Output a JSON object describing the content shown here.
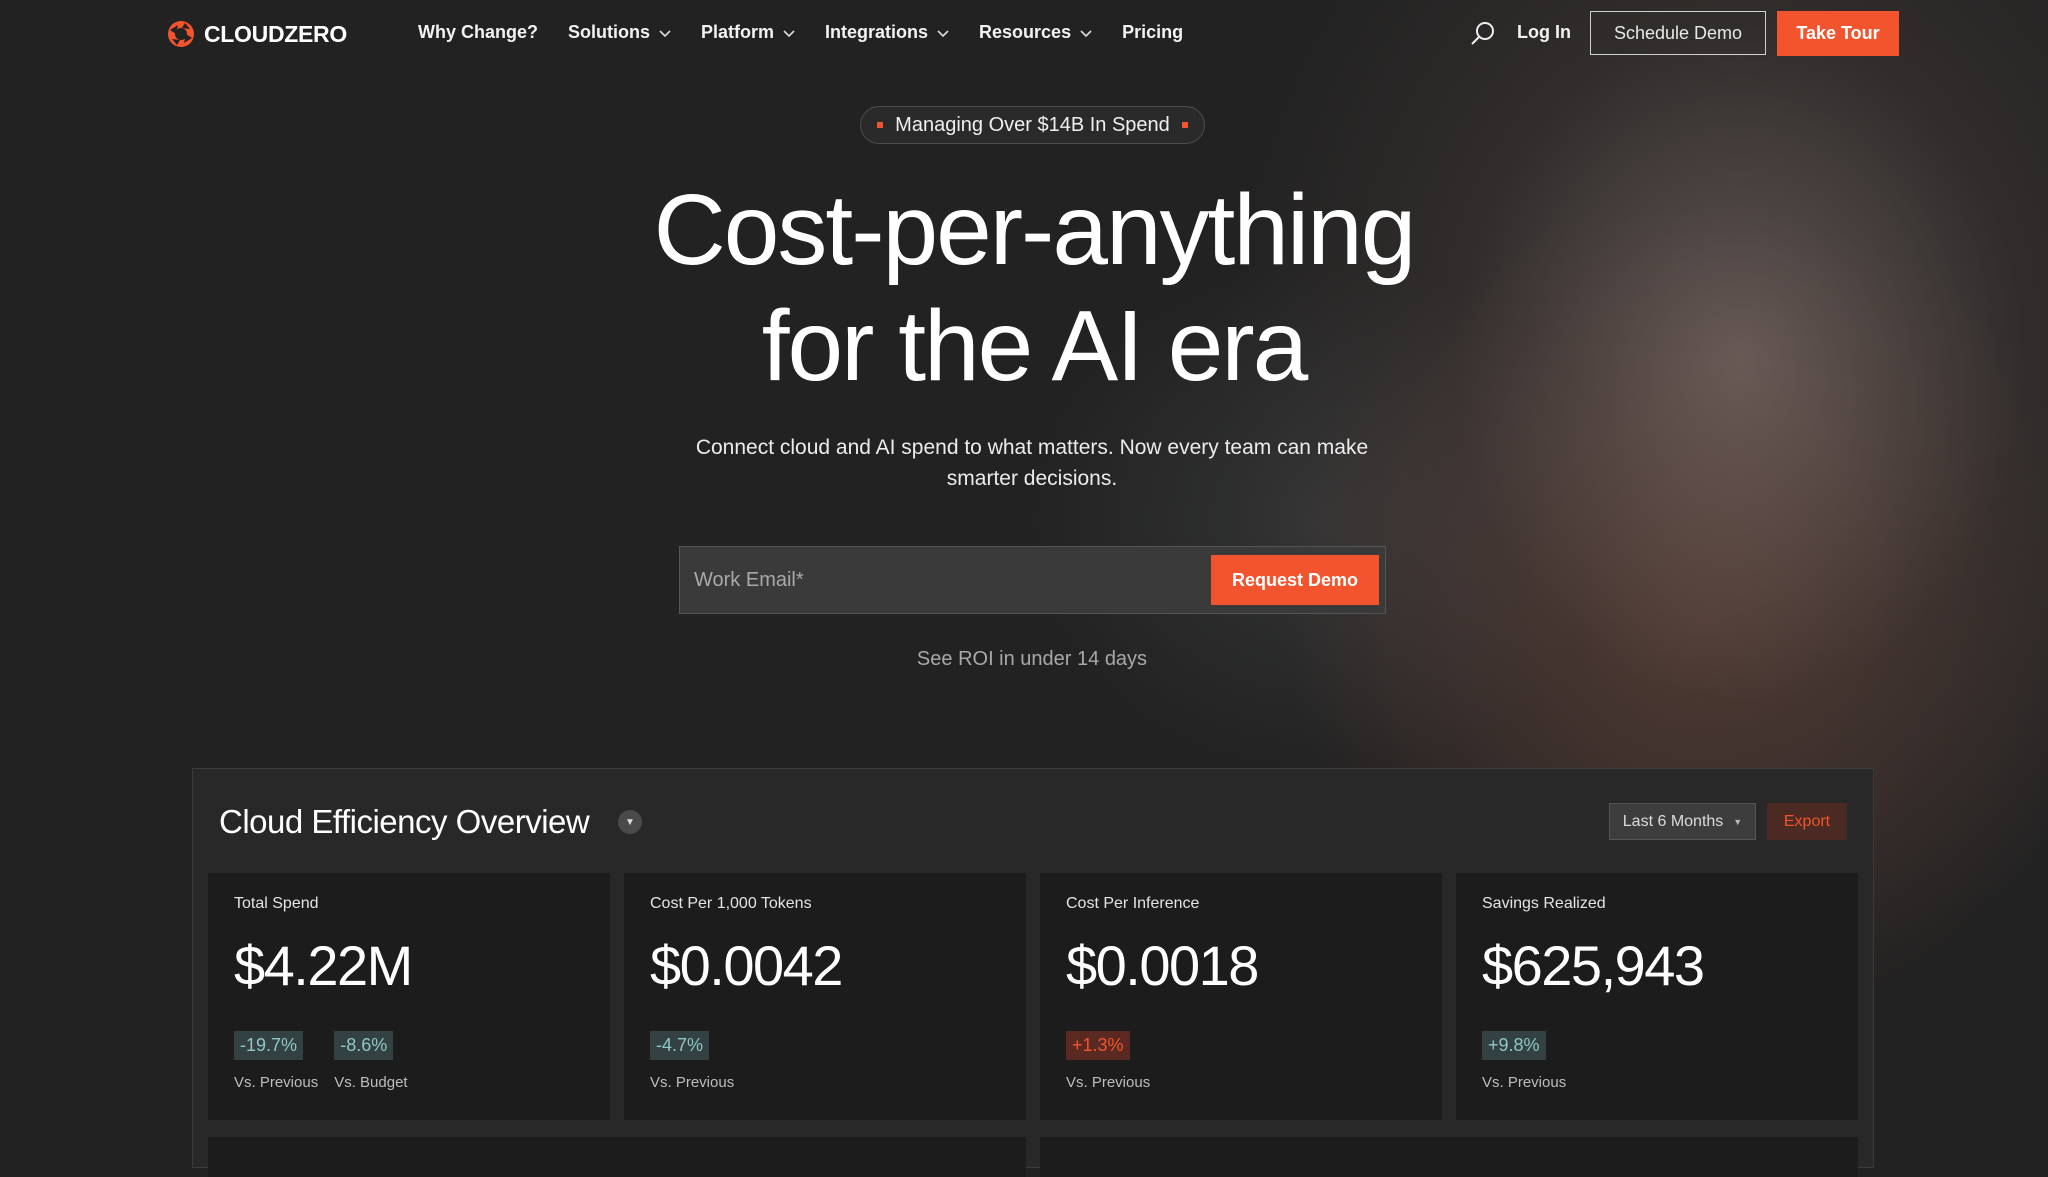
{
  "nav": {
    "brand": "CLOUDZERO",
    "menu": [
      {
        "label": "Why Change?",
        "dropdown": false
      },
      {
        "label": "Solutions",
        "dropdown": true
      },
      {
        "label": "Platform",
        "dropdown": true
      },
      {
        "label": "Integrations",
        "dropdown": true
      },
      {
        "label": "Resources",
        "dropdown": true
      },
      {
        "label": "Pricing",
        "dropdown": false
      }
    ],
    "login": "Log In",
    "schedule_demo": "Schedule Demo",
    "take_tour": "Take Tour"
  },
  "hero": {
    "pill": "Managing Over $14B In Spend",
    "headline_line1": "Cost-per-anything",
    "headline_line2": "for the AI era",
    "subtext": "Connect cloud and AI spend to what matters. Now every team can make smarter decisions.",
    "email_placeholder": "Work Email*",
    "request_demo": "Request Demo",
    "roi_note": "See ROI in under 14 days"
  },
  "dashboard": {
    "title": "Cloud Efficiency Overview",
    "range": "Last 6 Months",
    "export": "Export",
    "cards": [
      {
        "label": "Total Spend",
        "value": "$4.22M",
        "badges": [
          {
            "delta": "-19.7%",
            "caption": "Vs. Previous",
            "tone": "neg"
          },
          {
            "delta": "-8.6%",
            "caption": "Vs. Budget",
            "tone": "neg"
          }
        ]
      },
      {
        "label": "Cost Per 1,000 Tokens",
        "value": "$0.0042",
        "badges": [
          {
            "delta": "-4.7%",
            "caption": "Vs. Previous",
            "tone": "neg"
          }
        ]
      },
      {
        "label": "Cost Per Inference",
        "value": "$0.0018",
        "badges": [
          {
            "delta": "+1.3%",
            "caption": "Vs. Previous",
            "tone": "pos-bad"
          }
        ]
      },
      {
        "label": "Savings Realized",
        "value": "$625,943",
        "badges": [
          {
            "delta": "+9.8%",
            "caption": "Vs. Previous",
            "tone": "pos-good"
          }
        ]
      }
    ]
  },
  "colors": {
    "accent": "#f2542d",
    "background": "#222222",
    "card": "#1c1c1c"
  }
}
